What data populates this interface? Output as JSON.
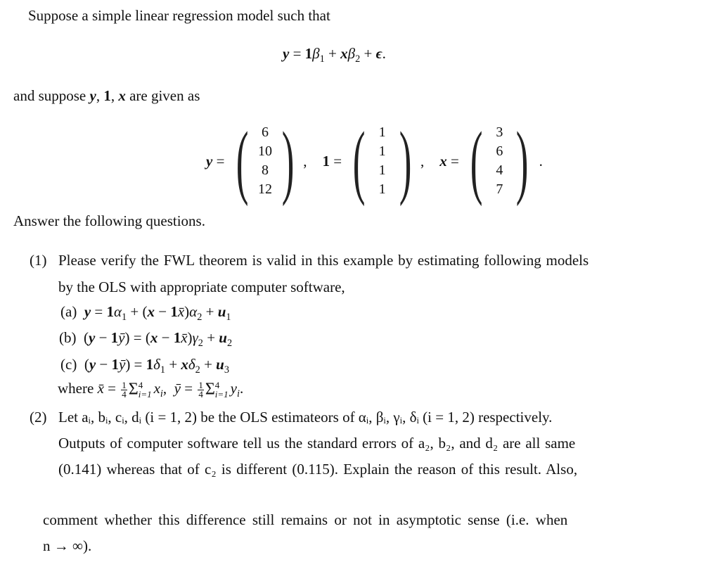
{
  "intro": "Suppose a simple linear regression model such that",
  "model_equation": {
    "lhs": "y",
    "rhs_parts": [
      "1",
      "β",
      "1",
      "+",
      "x",
      "β",
      "2",
      "+",
      "ϵ",
      "."
    ]
  },
  "given_text": {
    "prefix": "and suppose",
    "vars": [
      "y",
      "1",
      "x"
    ],
    "suffix": "are given as"
  },
  "vectors": [
    {
      "name": "y",
      "values": [
        "6",
        "10",
        "8",
        "12"
      ]
    },
    {
      "name": "1",
      "values": [
        "1",
        "1",
        "1",
        "1"
      ]
    },
    {
      "name": "x",
      "values": [
        "3",
        "6",
        "4",
        "7"
      ]
    }
  ],
  "answer_prompt": "Answer the following questions.",
  "q1": {
    "number": "(1)",
    "text_line1": "Please verify the FWL theorem is valid in this example by estimating following models",
    "text_line2": "by the OLS with appropriate computer software,",
    "models": [
      {
        "label": "(a)",
        "equation": "y = 1α₁ + (x − 1x̄)α₂ + u₁"
      },
      {
        "label": "(b)",
        "equation": "(y − 1ȳ) = (x − 1x̄)γ₂ + u₂"
      },
      {
        "label": "(c)",
        "equation": "(y − 1ȳ) = 1δ₁ + xδ₂ + u₃"
      }
    ],
    "where_text": "where",
    "frac_num": "1",
    "frac_den": "4",
    "sum_upper": "4",
    "sum_lower": "i=1"
  },
  "q2": {
    "number": "(2)",
    "line1": "Let aᵢ, bᵢ, cᵢ, dᵢ (i = 1, 2) be the OLS estimateors of αᵢ, βᵢ, γᵢ, δᵢ (i = 1, 2) respectively.",
    "line2": "Outputs of computer software tell us the standard errors of a₂, b₂, and d₂ are all same",
    "line3": "(0.141) whereas that of c₂ is different (0.115). Explain the reason of this result. Also,",
    "line4": "comment whether this difference still remains or not in asymptotic sense (i.e.  when",
    "line5": "n → ∞)."
  }
}
